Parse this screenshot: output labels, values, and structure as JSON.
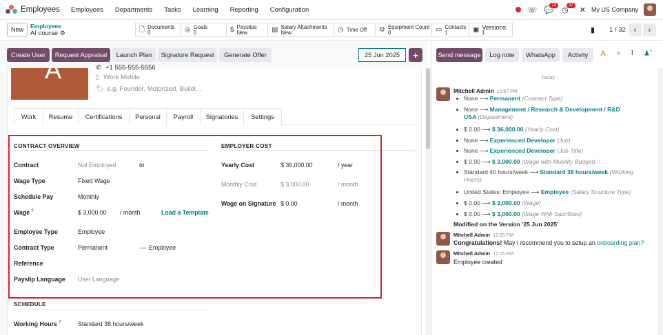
{
  "topbar": {
    "app_title": "Employees",
    "menu": [
      "Employees",
      "Departments",
      "Tasks",
      "Learning",
      "Reporting",
      "Configuration"
    ],
    "chat_badge": "13",
    "activity_badge": "37",
    "company": "My US Company"
  },
  "control": {
    "new_label": "New",
    "breadcrumb_parent": "Employees",
    "breadcrumb_current": "AI course",
    "pager": "1 / 32",
    "smart_buttons": [
      {
        "icon": "document-icon",
        "glyph": "🗋",
        "label": "Documents",
        "value": "0"
      },
      {
        "icon": "goals-icon",
        "glyph": "◎",
        "label": "Goals",
        "value": "0"
      },
      {
        "icon": "dollar-icon",
        "glyph": "$",
        "label": "Payslips",
        "value": "New"
      },
      {
        "icon": "money-icon",
        "glyph": "▤",
        "label": "Salary Attachments",
        "value": "New"
      },
      {
        "icon": "clock-icon",
        "glyph": "◷",
        "label": "Time Off",
        "value": ""
      },
      {
        "icon": "equipment-icon",
        "glyph": "⚙",
        "label": "Equipment Count",
        "value": "0"
      },
      {
        "icon": "contacts-icon",
        "glyph": "▭",
        "label": "Contacts",
        "value": "1"
      },
      {
        "icon": "versions-icon",
        "glyph": "▣",
        "label": "Versions",
        "value": "1"
      }
    ]
  },
  "actions": {
    "create_user": "Create User",
    "request_appraisal": "Request Appraisal",
    "launch_plan": "Launch Plan",
    "signature_request": "Signature Request",
    "generate_offer": "Generate Offer",
    "date": "25 Jun 2025",
    "plus": "+"
  },
  "employee": {
    "avatar_letter": "A",
    "phone": "+1 555-555-5556",
    "work_mobile_placeholder": "Work Mobile",
    "tags_placeholder": "e.g. Founder, Motorized, Buildi..."
  },
  "tabs": [
    "Work",
    "Resume",
    "Certifications",
    "Personal",
    "Payroll",
    "Signatories",
    "Settings"
  ],
  "contract_overview": {
    "title": "CONTRACT OVERVIEW",
    "contract_label": "Contract",
    "contract_value": "Not Employed",
    "contract_to": "to",
    "wage_type_label": "Wage Type",
    "wage_type_value": "Fixed Wage",
    "schedule_pay_label": "Schedule Pay",
    "schedule_pay_value": "Monthly",
    "wage_label": "Wage",
    "wage_help": "?",
    "wage_value": "$ 3,000.00",
    "wage_period": "/ month",
    "load_template": "Load a Template",
    "employee_type_label": "Employee Type",
    "employee_type_value": "Employee",
    "contract_type_label": "Contract Type",
    "contract_type_value": "Permanent",
    "contract_type_dash": "—",
    "contract_type_extra": "Employee",
    "reference_label": "Reference",
    "payslip_language_label": "Payslip Language",
    "payslip_language_placeholder": "User Language"
  },
  "employer_cost": {
    "title": "EMPLOYER COST",
    "yearly_cost_label": "Yearly Cost",
    "yearly_cost_value": "$ 36,000.00",
    "yearly_cost_period": "/ year",
    "monthly_cost_label": "Monthly Cost",
    "monthly_cost_value": "$ 3,000.00",
    "monthly_cost_period": "/ month",
    "wage_on_signature_label": "Wage on Signature",
    "wage_on_signature_value": "$ 0.00",
    "wage_on_signature_period": "/ month"
  },
  "schedule": {
    "title": "SCHEDULE",
    "working_hours_label": "Working Hours",
    "working_hours_help": "?",
    "working_hours_value": "Standard 38 hours/week"
  },
  "chatter": {
    "send_message": "Send message",
    "log_note": "Log note",
    "whatsapp": "WhatsApp",
    "activity": "Activity",
    "followers": "1",
    "today": "Today",
    "msg1": {
      "author": "Mitchell Admin",
      "time": "12:57 PM",
      "tracking": [
        {
          "old": "None",
          "new": "Permanent",
          "field": "(Contract Type)"
        },
        {
          "old": "None",
          "new": "Management / Research & Development / R&D",
          "new2": "USA",
          "field": "(Department)"
        },
        {
          "old": "$ 0.00",
          "new": "$ 36,000.00",
          "field": "(Yearly Cost)"
        },
        {
          "old": "None",
          "new": "Experienced Developer",
          "field": "(Job)"
        },
        {
          "old": "None",
          "new": "Experienced Developer",
          "field": "(Job Title)"
        },
        {
          "old": "$ 0.00",
          "new": "$ 3,000.00",
          "field": "(Wage with Mobility Budget)"
        },
        {
          "old": "Standard 40 hours/week",
          "new": "Standard 38 hours/week",
          "field": "(Working",
          "field2": "Hours)"
        },
        {
          "old": "United States: Employee",
          "new": "Employee",
          "field": "(Salary Structure Type)"
        },
        {
          "old": "$ 0.00",
          "new": "$ 3,000.00",
          "field": "(Wage)"
        },
        {
          "old": "$ 0.00",
          "new": "$ 3,000.00",
          "field": "(Wage With Sacrifices)"
        }
      ],
      "footer": "Modified on the Version '25 Jun 2025'"
    },
    "msg2": {
      "author": "Mitchell Admin",
      "time": "12:25 PM",
      "bold": "Congratulations!",
      "text": " May I recommend you to setup an ",
      "link": "onboarding plan?"
    },
    "msg3": {
      "author": "Mitchell Admin",
      "time": "12:25 PM",
      "text": "Employee created"
    }
  },
  "colors": {
    "brand": "#714b67",
    "accent": "#017e84",
    "highlight": "#d9222a"
  }
}
